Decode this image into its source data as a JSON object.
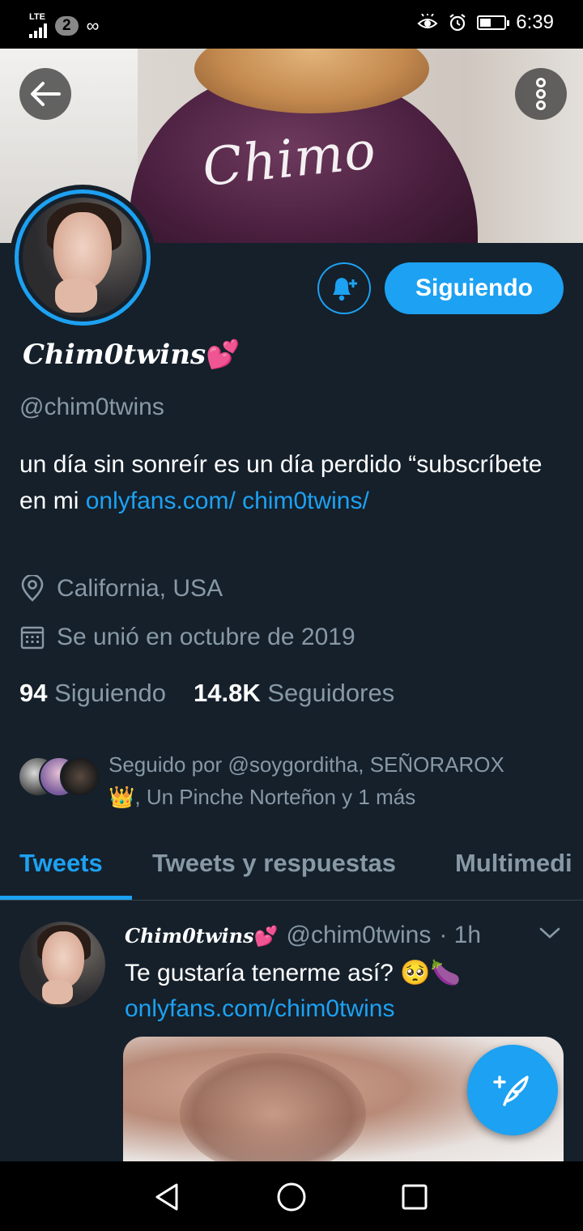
{
  "status_bar": {
    "network": "LTE",
    "sim_badge": "2",
    "voicemail_icon": "∞",
    "time": "6:39",
    "battery_level": 0.4
  },
  "banner": {
    "text": "Chimo",
    "back_icon": "arrow-left-icon",
    "more_icon": "more-vertical-icon"
  },
  "profile": {
    "display_name": "Chim0twins",
    "display_name_emoji": "💕",
    "handle": "@chim0twins",
    "bio_text": "un día sin sonreír es un día perdido “subscríbete en mi ",
    "bio_link": "onlyfans.com/ chim0twins/",
    "location": "California, USA",
    "joined": "Se unió en octubre de 2019",
    "following_count": "94",
    "following_label": "Siguiendo",
    "followers_count": "14.8K",
    "followers_label": "Seguidores",
    "followed_by": "Seguido por @soygorditha, SEÑORAROX",
    "followed_by_line2": ", Un Pinche Norteñon y 1 más",
    "followed_by_emoji": "👑"
  },
  "actions": {
    "follow_label": "Siguiendo",
    "bell_icon": "bell-plus-icon"
  },
  "tabs": [
    {
      "label": "Tweets",
      "active": true
    },
    {
      "label": "Tweets y respuestas",
      "active": false
    },
    {
      "label": "Multimedi",
      "active": false
    }
  ],
  "tweet": {
    "name": "Chim0twins",
    "name_emoji": "💕",
    "handle": "@chim0twins",
    "time": "· 1h",
    "text": "Te gustaría tenerme así? ",
    "emojis": "🥺🍆",
    "link": "onlyfans.com/chim0twins"
  },
  "colors": {
    "background": "#15202b",
    "accent": "#1da1f2",
    "secondary_text": "#8899a6",
    "divider": "#38444d"
  }
}
